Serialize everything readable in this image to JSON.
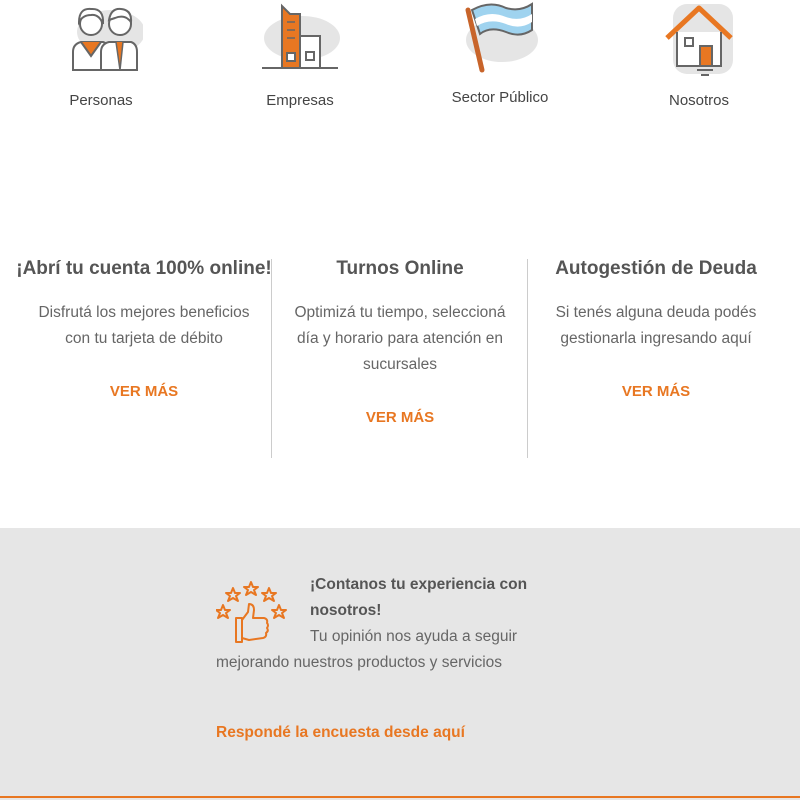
{
  "categories": [
    {
      "label": "Personas",
      "icon": "people-icon"
    },
    {
      "label": "Empresas",
      "icon": "buildings-icon"
    },
    {
      "label": "Sector Público",
      "icon": "flag-icon"
    },
    {
      "label": "Nosotros",
      "icon": "house-icon"
    }
  ],
  "cards": [
    {
      "title": "¡Abrí tu cuenta 100% online!",
      "text": "Disfrutá los mejores beneficios con tu tarjeta de débito",
      "link": "VER MÁS"
    },
    {
      "title": "Turnos Online",
      "text": "Optimizá tu tiempo, seleccioná día y horario para atención en sucursales",
      "link": "VER MÁS"
    },
    {
      "title": "Autogestión de Deuda",
      "text": "Si tenés alguna deuda podés gestionarla ingresando aquí",
      "link": "VER MÁS"
    }
  ],
  "feedback": {
    "icon": "thumbs-up-stars-icon",
    "title": "¡Contanos tu experiencia con nosotros!",
    "text": "Tu opinión nos ayuda a seguir mejorando nuestros productos y servicios",
    "link": "Respondé la encuesta desde aquí"
  },
  "colors": {
    "accent": "#e87722",
    "band": "#e6e6e6",
    "text": "#555555"
  }
}
